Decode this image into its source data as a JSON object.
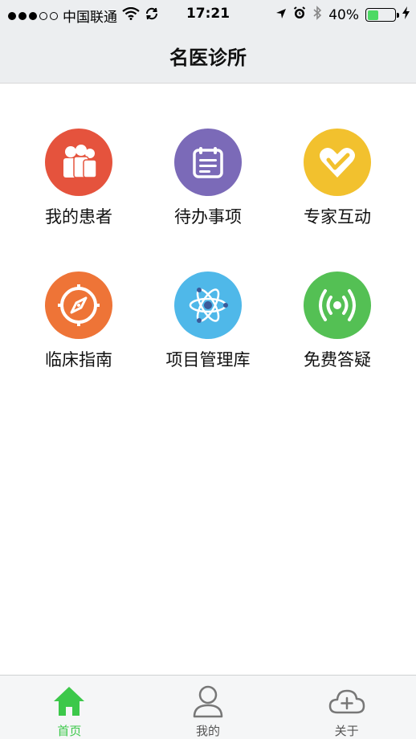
{
  "status_bar": {
    "carrier": "中国联通",
    "time": "17:21",
    "battery_text": "40%",
    "battery_level": 0.4,
    "icons": [
      "signal-dots",
      "wifi-icon",
      "sync-icon",
      "location-arrow-icon",
      "alarm-icon",
      "bluetooth-icon",
      "battery-icon",
      "charging-bolt-icon"
    ]
  },
  "nav": {
    "title": "名医诊所"
  },
  "grid": {
    "items": [
      {
        "label": "我的患者",
        "icon": "patients-icon",
        "color": "#e5533d"
      },
      {
        "label": "待办事项",
        "icon": "calendar-icon",
        "color": "#7b6ab8"
      },
      {
        "label": "专家互动",
        "icon": "heart-hand-icon",
        "color": "#f2c12e"
      },
      {
        "label": "临床指南",
        "icon": "compass-icon",
        "color": "#ee7437"
      },
      {
        "label": "项目管理库",
        "icon": "atom-icon",
        "color": "#4fb8e9"
      },
      {
        "label": "免费答疑",
        "icon": "broadcast-icon",
        "color": "#54c054"
      }
    ]
  },
  "tab_bar": {
    "active_color": "#3cc84a",
    "tabs": [
      {
        "label": "首页",
        "icon": "home-icon",
        "active": true
      },
      {
        "label": "我的",
        "icon": "user-icon",
        "active": false
      },
      {
        "label": "关于",
        "icon": "cloud-plus-icon",
        "active": false
      }
    ]
  }
}
